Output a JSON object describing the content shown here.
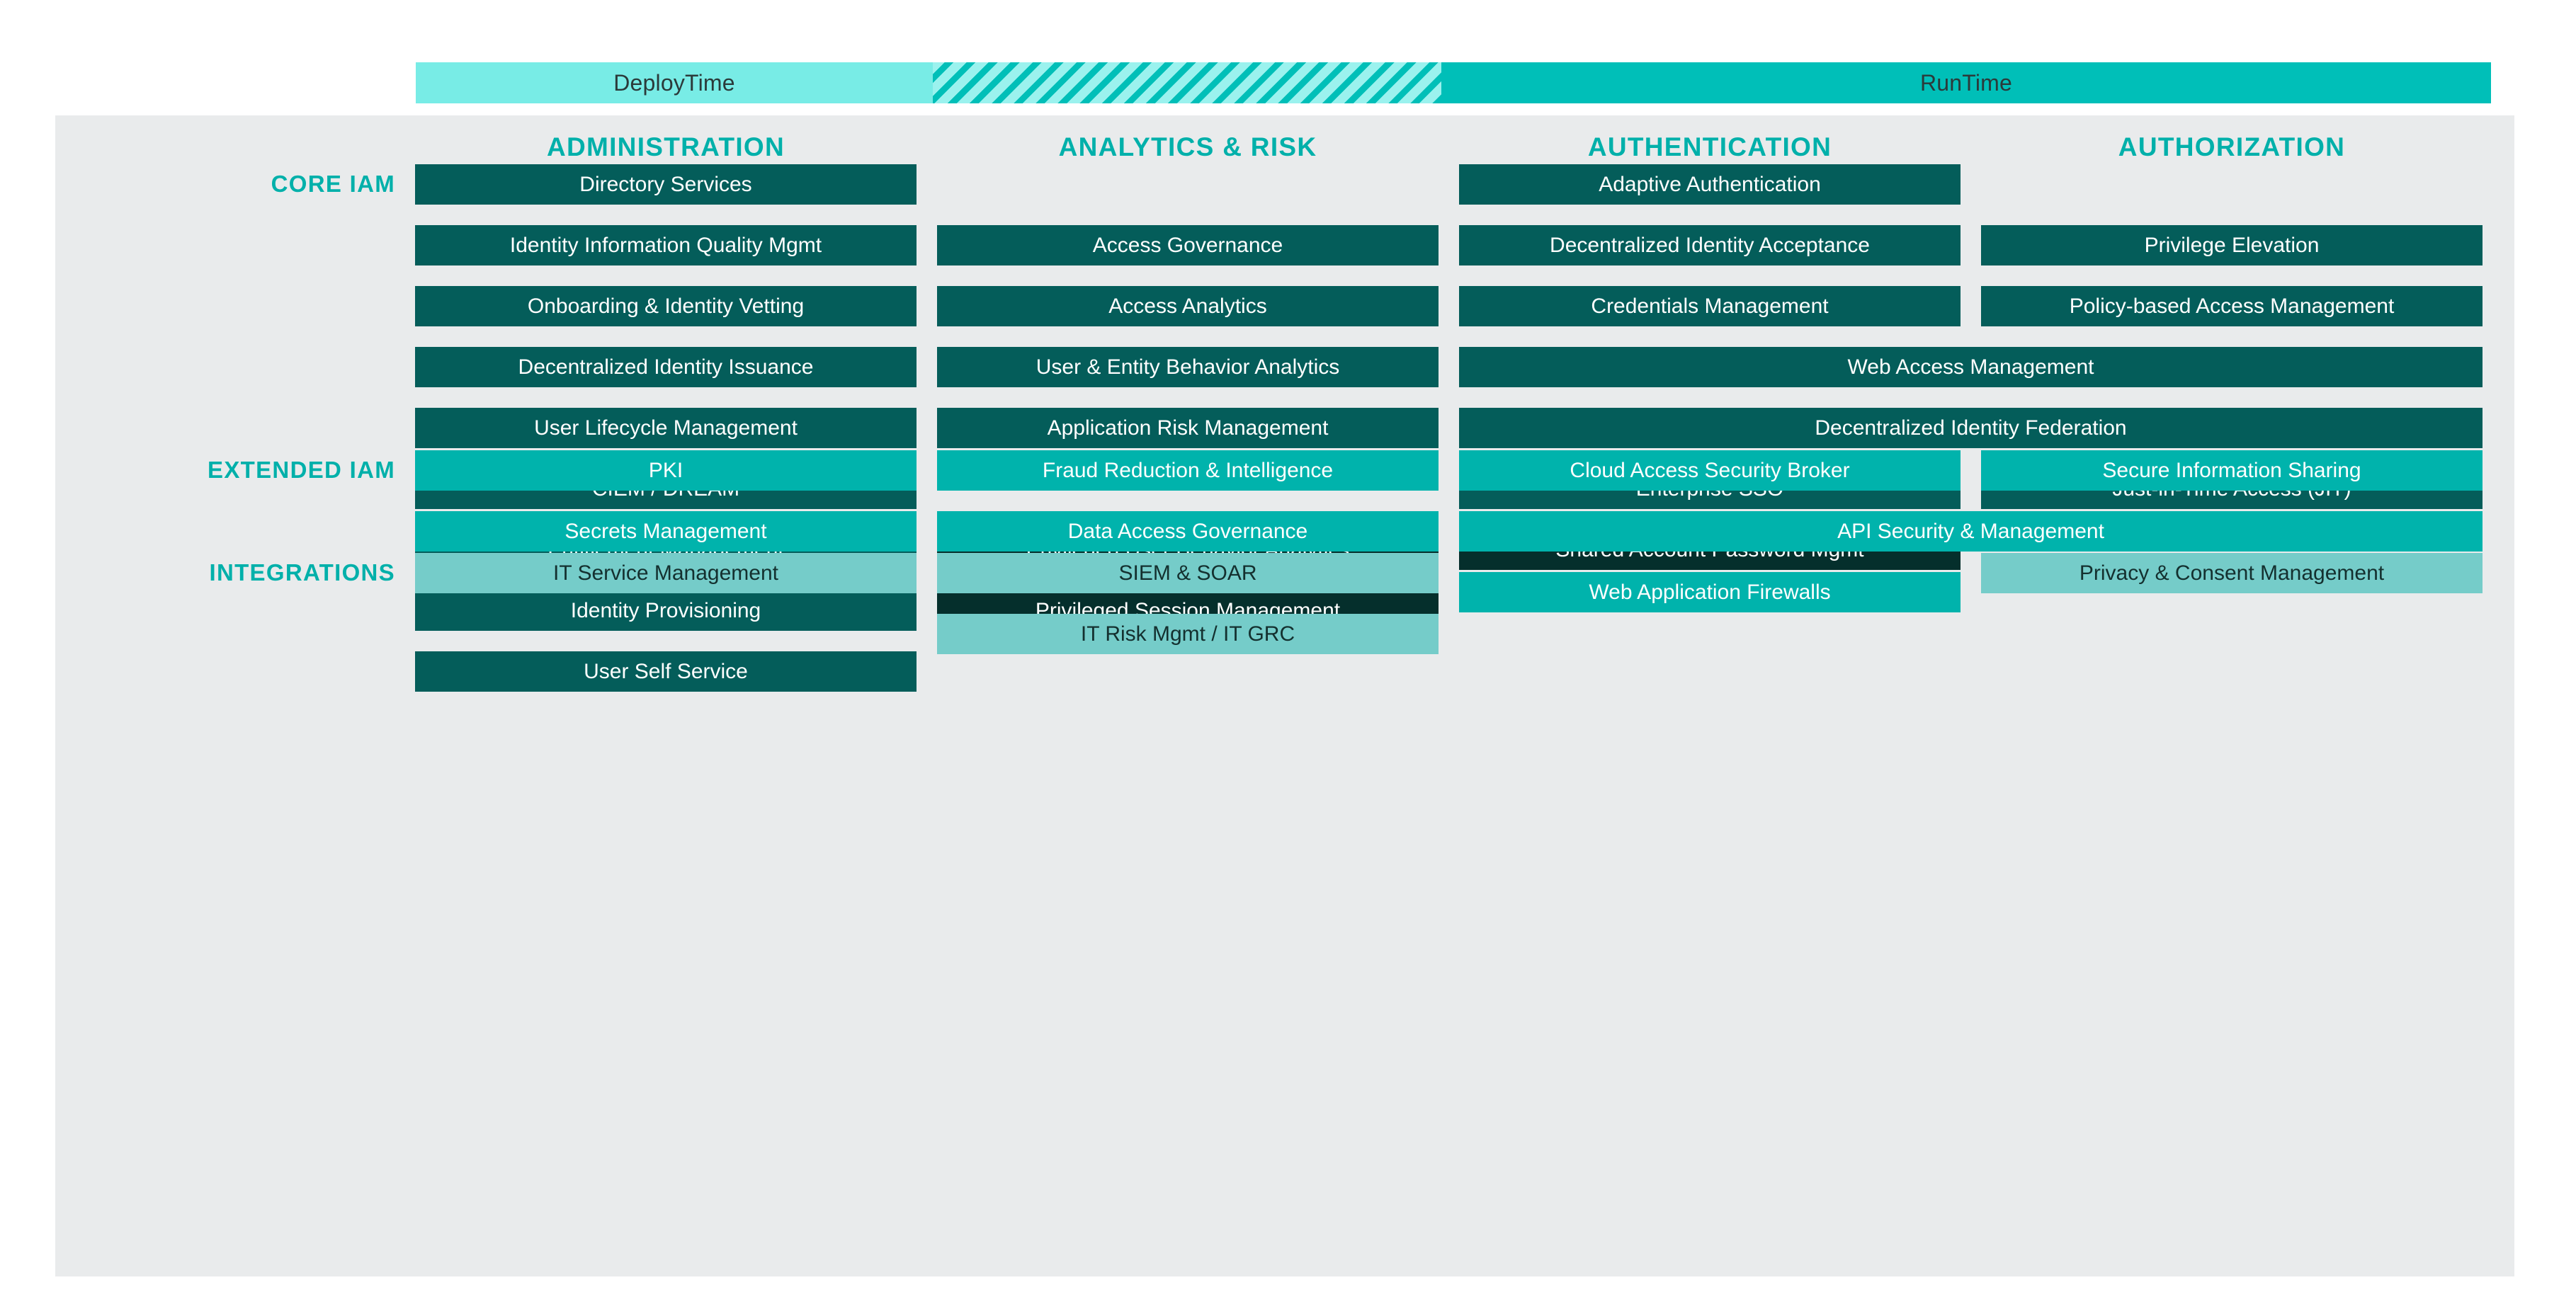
{
  "timeline": {
    "segments": [
      {
        "id": "deploytime",
        "label": "DeployTime",
        "style": "solid",
        "color": "#78ECE6"
      },
      {
        "id": "transition",
        "label": "",
        "style": "striped",
        "color": "#9BF2EE"
      },
      {
        "id": "runtime",
        "label": "RunTime",
        "style": "solid",
        "color": "#00BFB8"
      }
    ]
  },
  "columns": [
    {
      "id": "administration",
      "label": "ADMINISTRATION"
    },
    {
      "id": "analytics-risk",
      "label": "ANALYTICS & RISK"
    },
    {
      "id": "authentication",
      "label": "AUTHENTICATION"
    },
    {
      "id": "authorization",
      "label": "AUTHORIZATION"
    }
  ],
  "bands": [
    {
      "id": "core-iam",
      "label": "CORE IAM"
    },
    {
      "id": "extended-iam",
      "label": "EXTENDED IAM"
    },
    {
      "id": "integrations",
      "label": "INTEGRATIONS"
    }
  ],
  "legend_colors": {
    "core": "#045D5A",
    "privileged": "#052F2C",
    "extended": "#00B3AC",
    "integration": "#75CCC9",
    "accent": "#00B0AA",
    "panel": "#E9EBEC"
  },
  "tiles": [
    {
      "label": "Directory Services",
      "band": "core-iam",
      "column": "administration",
      "span": 1,
      "kind": "core",
      "row": 0
    },
    {
      "label": "Identity Information Quality Mgmt",
      "band": "core-iam",
      "column": "administration",
      "span": 1,
      "kind": "core",
      "row": 1
    },
    {
      "label": "Onboarding & Identity Vetting",
      "band": "core-iam",
      "column": "administration",
      "span": 1,
      "kind": "core",
      "row": 2
    },
    {
      "label": "Decentralized Identity Issuance",
      "band": "core-iam",
      "column": "administration",
      "span": 1,
      "kind": "core",
      "row": 3
    },
    {
      "label": "User Lifecycle Management",
      "band": "core-iam",
      "column": "administration",
      "span": 1,
      "kind": "core",
      "row": 4
    },
    {
      "label": "CIEM / DREAM",
      "band": "core-iam",
      "column": "administration",
      "span": 1,
      "kind": "core",
      "row": 5
    },
    {
      "label": "Entitlement Management",
      "band": "core-iam",
      "column": "administration",
      "span": 1,
      "kind": "core",
      "row": 6
    },
    {
      "label": "Identity Provisioning",
      "band": "core-iam",
      "column": "administration",
      "span": 1,
      "kind": "core",
      "row": 7
    },
    {
      "label": "User Self Service",
      "band": "core-iam",
      "column": "administration",
      "span": 1,
      "kind": "core",
      "row": 8
    },
    {
      "label": "Access Governance",
      "band": "core-iam",
      "column": "analytics-risk",
      "span": 1,
      "kind": "core",
      "row": 1
    },
    {
      "label": "Access Analytics",
      "band": "core-iam",
      "column": "analytics-risk",
      "span": 1,
      "kind": "core",
      "row": 2
    },
    {
      "label": "User & Entity Behavior Analytics",
      "band": "core-iam",
      "column": "analytics-risk",
      "span": 1,
      "kind": "core",
      "row": 3
    },
    {
      "label": "Application Risk Management",
      "band": "core-iam",
      "column": "analytics-risk",
      "span": 1,
      "kind": "core",
      "row": 4
    },
    {
      "label": "Privileged User Behavior Analytics",
      "band": "core-iam",
      "column": "analytics-risk",
      "span": 1,
      "kind": "privileged",
      "row": 6
    },
    {
      "label": "Privileged Session Management",
      "band": "core-iam",
      "column": "analytics-risk",
      "span": 1,
      "kind": "privileged",
      "row": 7
    },
    {
      "label": "Adaptive Authentication",
      "band": "core-iam",
      "column": "authentication",
      "span": 1,
      "kind": "core",
      "row": 0
    },
    {
      "label": "Decentralized Identity Acceptance",
      "band": "core-iam",
      "column": "authentication",
      "span": 1,
      "kind": "core",
      "row": 1
    },
    {
      "label": "Credentials Management",
      "band": "core-iam",
      "column": "authentication",
      "span": 1,
      "kind": "core",
      "row": 2
    },
    {
      "label": "Web Access Management",
      "band": "core-iam",
      "column": "authentication",
      "span": 2,
      "kind": "core",
      "row": 3
    },
    {
      "label": "Decentralized Identity Federation",
      "band": "core-iam",
      "column": "authentication",
      "span": 2,
      "kind": "core",
      "row": 4
    },
    {
      "label": "Enterprise SSO",
      "band": "core-iam",
      "column": "authentication",
      "span": 1,
      "kind": "core",
      "row": 5
    },
    {
      "label": "Shared Account Password Mgmt",
      "band": "core-iam",
      "column": "authentication",
      "span": 1,
      "kind": "privileged",
      "row": 6
    },
    {
      "label": "Privilege Elevation",
      "band": "core-iam",
      "column": "authorization",
      "span": 1,
      "kind": "core",
      "row": 1
    },
    {
      "label": "Policy-based Access Management",
      "band": "core-iam",
      "column": "authorization",
      "span": 1,
      "kind": "core",
      "row": 2
    },
    {
      "label": "Just-in-Time Access (JIT)",
      "band": "core-iam",
      "column": "authorization",
      "span": 1,
      "kind": "core",
      "row": 5
    },
    {
      "label": "PKI",
      "band": "extended-iam",
      "column": "administration",
      "span": 1,
      "kind": "extended",
      "row": 0
    },
    {
      "label": "Secrets Management",
      "band": "extended-iam",
      "column": "administration",
      "span": 1,
      "kind": "extended",
      "row": 1
    },
    {
      "label": "Fraud Reduction & Intelligence",
      "band": "extended-iam",
      "column": "analytics-risk",
      "span": 1,
      "kind": "extended",
      "row": 0
    },
    {
      "label": "Data Access Governance",
      "band": "extended-iam",
      "column": "analytics-risk",
      "span": 1,
      "kind": "extended",
      "row": 1
    },
    {
      "label": "Cloud Access Security Broker",
      "band": "extended-iam",
      "column": "authentication",
      "span": 1,
      "kind": "extended",
      "row": 0
    },
    {
      "label": "API Security & Management",
      "band": "extended-iam",
      "column": "authentication",
      "span": 2,
      "kind": "extended",
      "row": 1
    },
    {
      "label": "Web Application Firewalls",
      "band": "extended-iam",
      "column": "authentication",
      "span": 1,
      "kind": "extended",
      "row": 2
    },
    {
      "label": "Secure Information Sharing",
      "band": "extended-iam",
      "column": "authorization",
      "span": 1,
      "kind": "extended",
      "row": 0
    },
    {
      "label": "IT Service Management",
      "band": "integrations",
      "column": "administration",
      "span": 1,
      "kind": "integration",
      "row": 0
    },
    {
      "label": "SIEM & SOAR",
      "band": "integrations",
      "column": "analytics-risk",
      "span": 1,
      "kind": "integration",
      "row": 0
    },
    {
      "label": "IT Risk Mgmt / IT GRC",
      "band": "integrations",
      "column": "analytics-risk",
      "span": 1,
      "kind": "integration",
      "row": 1
    },
    {
      "label": "Privacy & Consent Management",
      "band": "integrations",
      "column": "authorization",
      "span": 1,
      "kind": "integration",
      "row": 0
    }
  ]
}
